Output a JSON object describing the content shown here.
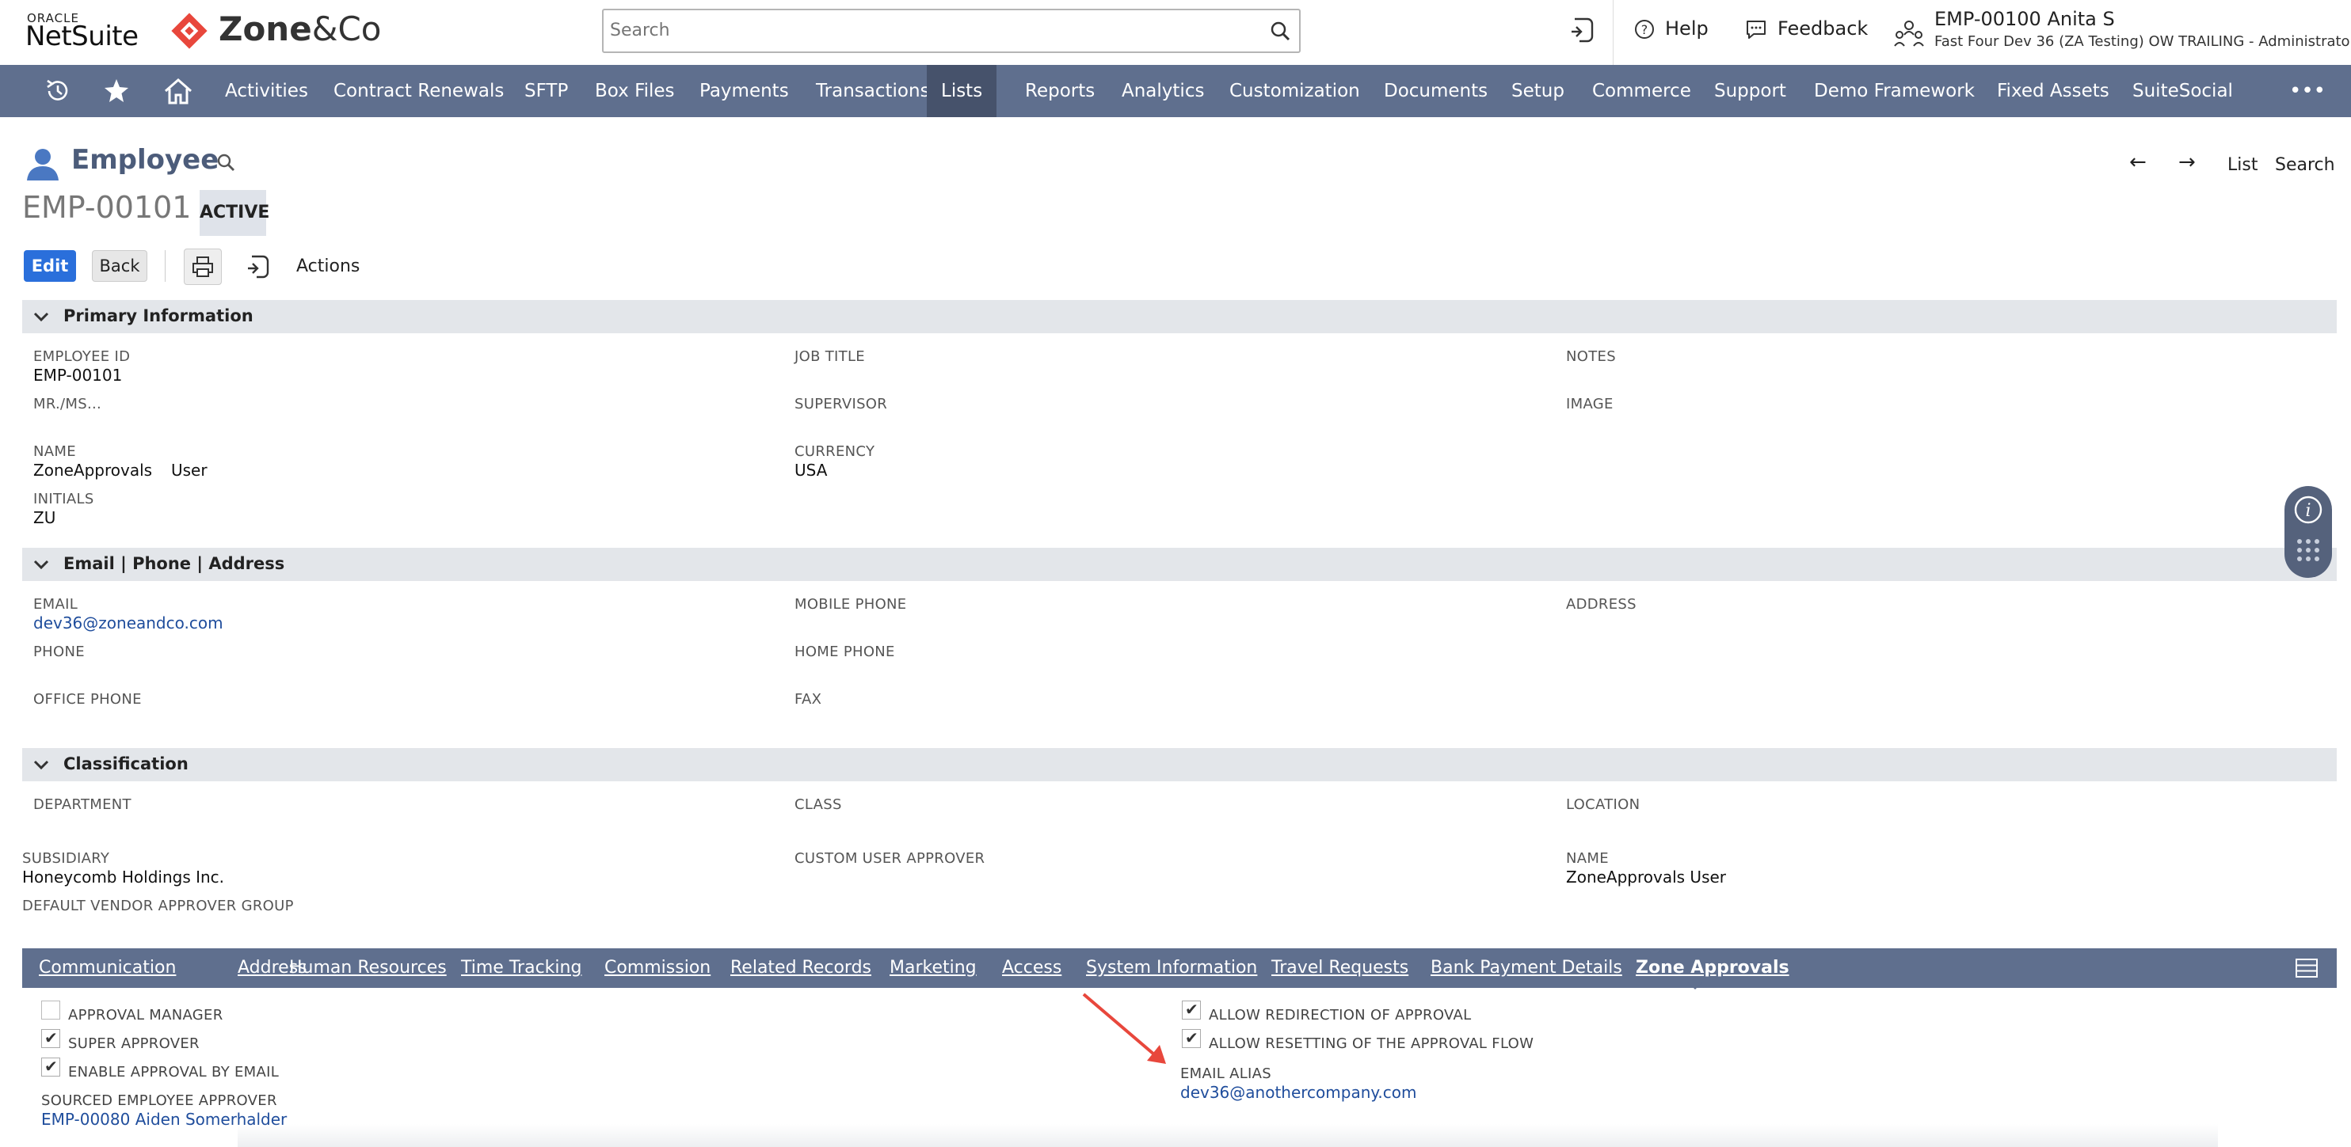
{
  "header": {
    "oracle": "ORACLE",
    "netsuite": "NetSuite",
    "zone_brand": "Zone",
    "zone_amp": "&Co",
    "search_placeholder": "Search",
    "help": "Help",
    "feedback": "Feedback",
    "user_name": "EMP-00100 Anita S",
    "user_account": "Fast Four Dev 36 (ZA Testing) OW TRAILING - Administrator"
  },
  "nav": {
    "items": [
      "Activities",
      "Contract Renewals",
      "SFTP",
      "Box Files",
      "Payments",
      "Transactions",
      "Lists",
      "Reports",
      "Analytics",
      "Customization",
      "Documents",
      "Setup",
      "Commerce",
      "Support",
      "Demo Framework",
      "Fixed Assets",
      "SuiteSocial"
    ],
    "active": "Lists",
    "more": "•••"
  },
  "record": {
    "type": "Employee",
    "id": "EMP-00101",
    "status": "ACTIVE",
    "nav_list": "List",
    "nav_search": "Search"
  },
  "buttons": {
    "edit": "Edit",
    "back": "Back",
    "actions": "Actions"
  },
  "sections": {
    "primary": {
      "title": "Primary Information",
      "employee_id_label": "EMPLOYEE ID",
      "employee_id": "EMP-00101",
      "mrms_label": "MR./MS...",
      "name_label": "NAME",
      "first_name": "ZoneApprovals",
      "last_name": "User",
      "initials_label": "INITIALS",
      "initials": "ZU",
      "job_title_label": "JOB TITLE",
      "supervisor_label": "SUPERVISOR",
      "currency_label": "CURRENCY",
      "currency": "USA",
      "notes_label": "NOTES",
      "image_label": "IMAGE"
    },
    "contact": {
      "title": "Email | Phone | Address",
      "email_label": "EMAIL",
      "email": "dev36@zoneandco.com",
      "phone_label": "PHONE",
      "office_phone_label": "OFFICE PHONE",
      "mobile_phone_label": "MOBILE PHONE",
      "home_phone_label": "HOME PHONE",
      "fax_label": "FAX",
      "address_label": "ADDRESS"
    },
    "classification": {
      "title": "Classification",
      "department_label": "DEPARTMENT",
      "class_label": "CLASS",
      "location_label": "LOCATION",
      "subsidiary_label": "SUBSIDIARY",
      "subsidiary": "Honeycomb Holdings Inc.",
      "custom_user_approver_label": "CUSTOM USER APPROVER",
      "name_label": "NAME",
      "name": "ZoneApprovals User",
      "default_vendor_label": "DEFAULT VENDOR APPROVER GROUP"
    }
  },
  "tabs": {
    "items": [
      "Communication",
      "Address",
      "Human Resources",
      "Time Tracking",
      "Commission",
      "Related Records",
      "Marketing",
      "Access",
      "System Information",
      "Travel Requests",
      "Bank Payment Details",
      "Zone Approvals"
    ],
    "active": "Zone Approvals"
  },
  "zone_approvals": {
    "approval_manager": {
      "label": "APPROVAL MANAGER",
      "checked": false
    },
    "super_approver": {
      "label": "SUPER APPROVER",
      "checked": true
    },
    "enable_email": {
      "label": "ENABLE APPROVAL BY EMAIL",
      "checked": true
    },
    "sourced_label": "SOURCED EMPLOYEE APPROVER",
    "sourced_value": "EMP-00080 Aiden Somerhalder",
    "allow_redirection": {
      "label": "ALLOW REDIRECTION OF APPROVAL",
      "checked": true
    },
    "allow_resetting": {
      "label": "ALLOW RESETTING OF THE APPROVAL FLOW",
      "checked": true
    },
    "email_alias_label": "EMAIL ALIAS",
    "email_alias": "dev36@anothercompany.com"
  },
  "colors": {
    "nav_bg": "#5f6f8e",
    "nav_active": "#46526b",
    "accent": "#2a6fdb",
    "link": "#1f4d9c",
    "zone_red": "#e8473c",
    "annotation_arrow": "#e8473c"
  }
}
